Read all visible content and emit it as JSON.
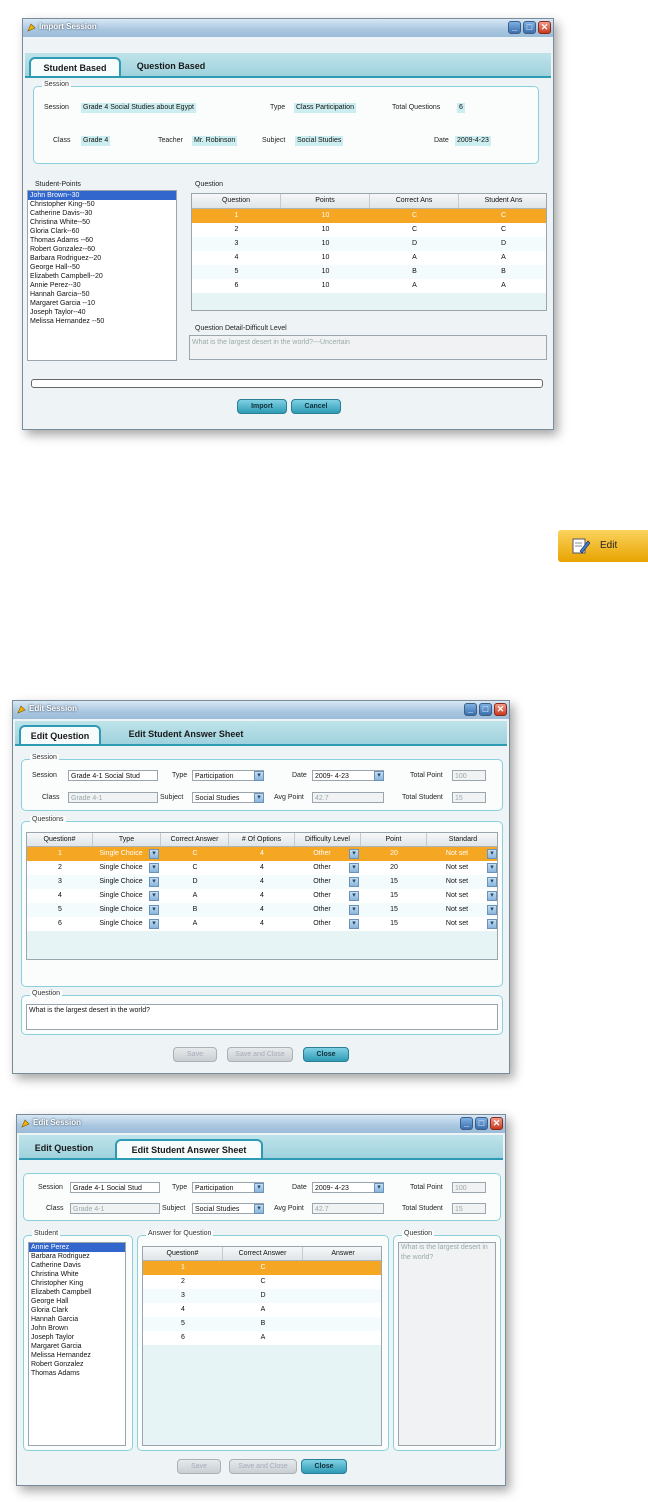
{
  "import_window": {
    "title": "Import Session",
    "tabs": [
      "Student Based",
      "Question Based"
    ],
    "session_group": "Session",
    "session_label": "Session",
    "session_value": "Grade 4 Social Studies about Egypt",
    "type_label": "Type",
    "type_value": "Class Participation",
    "total_questions_label": "Total Questions",
    "total_questions_value": "6",
    "class_label": "Class",
    "class_value": "Grade 4",
    "teacher_label": "Teacher",
    "teacher_value": "Mr. Robinson",
    "subject_label": "Subject",
    "subject_value": "Social Studies",
    "date_label": "Date",
    "date_value": "2009-4-23",
    "student_points_label": "Student-Points",
    "students": [
      "John Brown--30",
      "Christopher  King--50",
      "Catherine Davis--30",
      "Christina White--50",
      "Gloria Clark--60",
      "Thomas Adams --60",
      "Robert Gonzalez--60",
      "Barbara Rodriguez--20",
      "George Hall--50",
      "Elizabeth Campbell--20",
      "Annie Perez--30",
      "Hannah Garcia--50",
      "Margaret Garcia --10",
      "Joseph Taylor--40",
      "Melissa Hernandez --50"
    ],
    "question_label": "Question",
    "grid_headers": [
      "Question",
      "Points",
      "Correct Ans",
      "Student Ans"
    ],
    "grid_rows": [
      [
        "1",
        "10",
        "C",
        "C"
      ],
      [
        "2",
        "10",
        "C",
        "C"
      ],
      [
        "3",
        "10",
        "D",
        "D"
      ],
      [
        "4",
        "10",
        "A",
        "A"
      ],
      [
        "5",
        "10",
        "B",
        "B"
      ],
      [
        "6",
        "10",
        "A",
        "A"
      ]
    ],
    "detail_label": "Question Detail-Difficult Level",
    "detail_text": "What is the largest desert in the world?---Uncertain",
    "import_button": "Import",
    "cancel_button": "Cancel"
  },
  "edit_button": {
    "label": "Edit"
  },
  "edit_window_1": {
    "title": "Edit Session",
    "tabs": [
      "Edit Question",
      "Edit Student Answer Sheet"
    ],
    "session_group": "Session",
    "session_label": "Session",
    "session_value": "Grade 4-1 Social Stud",
    "type_label": "Type",
    "type_value": "Participation",
    "date_label": "Date",
    "date_value": "2009- 4-23",
    "total_point_label": "Total Point",
    "total_point_value": "100",
    "class_label": "Class",
    "class_value": "Grade 4-1",
    "subject_label": "Subject",
    "subject_value": "Social Studies",
    "avg_point_label": "Avg Point",
    "avg_point_value": "42.7",
    "total_student_label": "Total Student",
    "total_student_value": "15",
    "questions_group": "Questions",
    "grid_headers": [
      "Question#",
      "Type",
      "Correct Answer",
      "# Of Options",
      "Difficulty Level",
      "Point",
      "Standard"
    ],
    "grid_rows": [
      [
        "1",
        "Single Choice",
        "C",
        "4",
        "Other",
        "20",
        "Not set"
      ],
      [
        "2",
        "Single Choice",
        "C",
        "4",
        "Other",
        "20",
        "Not set"
      ],
      [
        "3",
        "Single Choice",
        "D",
        "4",
        "Other",
        "15",
        "Not set"
      ],
      [
        "4",
        "Single Choice",
        "A",
        "4",
        "Other",
        "15",
        "Not set"
      ],
      [
        "5",
        "Single Choice",
        "B",
        "4",
        "Other",
        "15",
        "Not set"
      ],
      [
        "6",
        "Single Choice",
        "A",
        "4",
        "Other",
        "15",
        "Not set"
      ]
    ],
    "question_group": "Question",
    "question_text": "What is the largest desert in the world?",
    "save_button": "Save",
    "save_close_button": "Save and Close",
    "close_button": "Close"
  },
  "edit_window_2": {
    "title": "Edit Session",
    "tabs": [
      "Edit Question",
      "Edit Student Answer Sheet"
    ],
    "session_label": "Session",
    "session_value": "Grade 4-1 Social Stud",
    "type_label": "Type",
    "type_value": "Participation",
    "date_label": "Date",
    "date_value": "2009- 4-23",
    "total_point_label": "Total Point",
    "total_point_value": "100",
    "class_label": "Class",
    "class_value": "Grade 4-1",
    "subject_label": "Subject",
    "subject_value": "Social Studies",
    "avg_point_label": "Avg Point",
    "avg_point_value": "42.7",
    "total_student_label": "Total Student",
    "total_student_value": "15",
    "student_group": "Student",
    "students": [
      "Annie Perez",
      "Barbara Rodriguez",
      "Catherine Davis",
      "Christina White",
      "Christopher King",
      "Elizabeth Campbell",
      "George Hall",
      "Gloria Clark",
      "Hannah Garcia",
      "John Brown",
      "Joseph Taylor",
      "Margaret Garcia",
      "Melissa Hernandez",
      "Robert Gonzalez",
      "Thomas Adams"
    ],
    "answer_group": "Answer for Question",
    "grid_headers": [
      "Question#",
      "Correct Answer",
      "Answer"
    ],
    "grid_rows": [
      [
        "1",
        "C",
        ""
      ],
      [
        "2",
        "C",
        ""
      ],
      [
        "3",
        "D",
        ""
      ],
      [
        "4",
        "A",
        ""
      ],
      [
        "5",
        "B",
        ""
      ],
      [
        "6",
        "A",
        ""
      ]
    ],
    "question_group": "Question",
    "question_text": "What is the largest desert in the world?",
    "save_button": "Save",
    "save_close_button": "Save and Close",
    "close_button": "Close"
  }
}
